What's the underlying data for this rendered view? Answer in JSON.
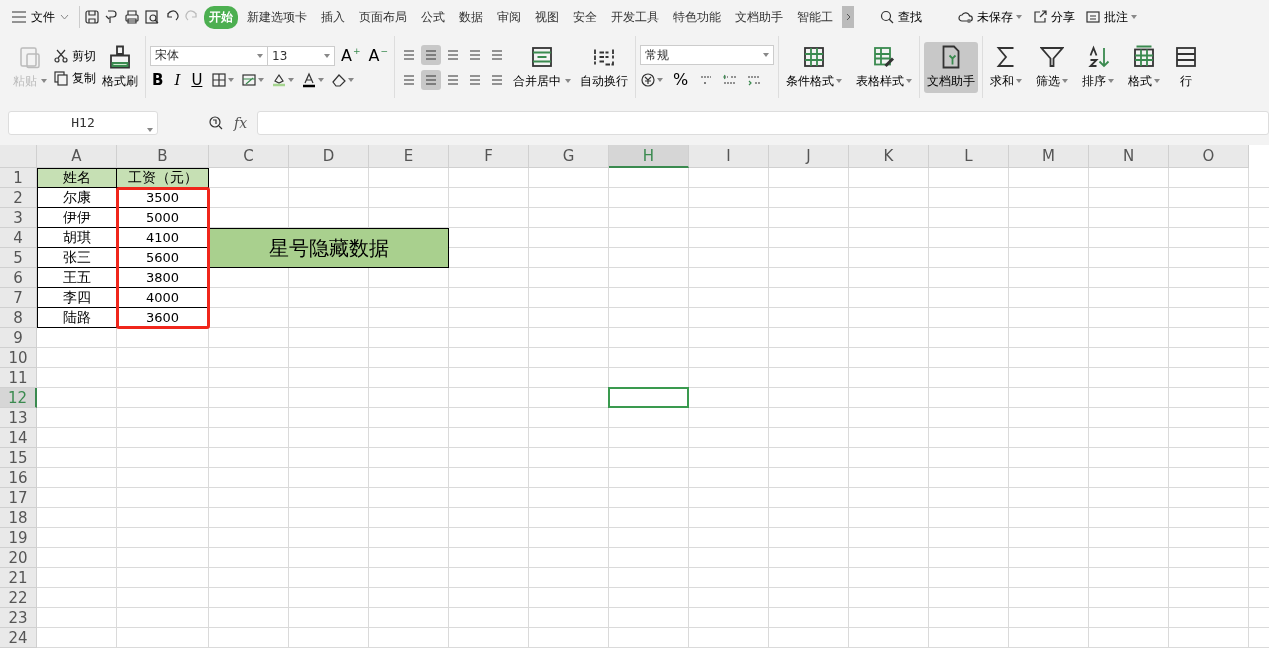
{
  "menu": {
    "label": "文件"
  },
  "tabs": [
    {
      "label": "开始",
      "selected": true
    },
    {
      "label": "新建选项卡",
      "selected": false
    },
    {
      "label": "插入",
      "selected": false
    },
    {
      "label": "页面布局",
      "selected": false
    },
    {
      "label": "公式",
      "selected": false
    },
    {
      "label": "数据",
      "selected": false
    },
    {
      "label": "审阅",
      "selected": false
    },
    {
      "label": "视图",
      "selected": false
    },
    {
      "label": "安全",
      "selected": false
    },
    {
      "label": "开发工具",
      "selected": false
    },
    {
      "label": "特色功能",
      "selected": false
    },
    {
      "label": "文档助手",
      "selected": false
    },
    {
      "label": "智能工",
      "selected": false
    }
  ],
  "actions": [
    {
      "label": "查找",
      "kind": "search",
      "dropdown": false
    },
    {
      "label": "未保存",
      "kind": "cloud",
      "dropdown": true
    },
    {
      "label": "分享",
      "kind": "share",
      "dropdown": false
    },
    {
      "label": "批注",
      "kind": "comment",
      "dropdown": true
    }
  ],
  "clipboard": {
    "paste": {
      "label": "粘贴",
      "disabled": true
    },
    "cut": "剪切",
    "copy": "复制",
    "painter": "格式刷"
  },
  "font": {
    "family": "宋体",
    "size": "13",
    "grow": {
      "text": "A",
      "mark": "+"
    },
    "shrink": {
      "text": "A",
      "mark": "−"
    },
    "styles": [
      "B",
      "I",
      "U"
    ]
  },
  "alignment": {
    "top": [
      {
        "selected": false
      },
      {
        "selected": true
      },
      {
        "selected": false
      },
      {
        "selected": false
      },
      {
        "selected": false
      }
    ],
    "bottom": [
      {
        "selected": false
      },
      {
        "selected": true
      },
      {
        "selected": false
      },
      {
        "selected": false
      },
      {
        "selected": false
      }
    ],
    "merge": "合并居中",
    "wrap": "自动换行"
  },
  "number": {
    "format": "常规",
    "percent": "%"
  },
  "large_buttons": [
    {
      "label": "条件格式",
      "kind": "cond",
      "dropdown": true,
      "selected": false
    },
    {
      "label": "表格样式",
      "kind": "style",
      "dropdown": true,
      "selected": false
    },
    {
      "label": "文档助手",
      "kind": "doc",
      "dropdown": false,
      "selected": true
    },
    {
      "label": "求和",
      "kind": "sum",
      "dropdown": true,
      "selected": false
    },
    {
      "label": "筛选",
      "kind": "filter",
      "dropdown": true,
      "selected": false
    },
    {
      "label": "排序",
      "kind": "sort",
      "dropdown": true,
      "selected": false
    },
    {
      "label": "格式",
      "kind": "format",
      "dropdown": true,
      "selected": false
    },
    {
      "label": "行",
      "kind": "rows",
      "dropdown": false,
      "selected": false
    }
  ],
  "name_box": "H12",
  "fx": "fx",
  "columns": [
    {
      "label": "A",
      "selected": false
    },
    {
      "label": "B",
      "selected": false
    },
    {
      "label": "C",
      "selected": false
    },
    {
      "label": "D",
      "selected": false
    },
    {
      "label": "E",
      "selected": false
    },
    {
      "label": "F",
      "selected": false
    },
    {
      "label": "G",
      "selected": false
    },
    {
      "label": "H",
      "selected": true
    },
    {
      "label": "I",
      "selected": false
    },
    {
      "label": "J",
      "selected": false
    },
    {
      "label": "K",
      "selected": false
    },
    {
      "label": "L",
      "selected": false
    },
    {
      "label": "M",
      "selected": false
    },
    {
      "label": "N",
      "selected": false
    },
    {
      "label": "O",
      "selected": false
    }
  ],
  "rows": [
    {
      "label": "1",
      "selected": false
    },
    {
      "label": "2",
      "selected": false
    },
    {
      "label": "3",
      "selected": false
    },
    {
      "label": "4",
      "selected": false
    },
    {
      "label": "5",
      "selected": false
    },
    {
      "label": "6",
      "selected": false
    },
    {
      "label": "7",
      "selected": false
    },
    {
      "label": "8",
      "selected": false
    },
    {
      "label": "9",
      "selected": false
    },
    {
      "label": "10",
      "selected": false
    },
    {
      "label": "11",
      "selected": false
    },
    {
      "label": "12",
      "selected": true
    },
    {
      "label": "13",
      "selected": false
    },
    {
      "label": "14",
      "selected": false
    },
    {
      "label": "15",
      "selected": false
    },
    {
      "label": "16",
      "selected": false
    },
    {
      "label": "17",
      "selected": false
    },
    {
      "label": "18",
      "selected": false
    },
    {
      "label": "19",
      "selected": false
    },
    {
      "label": "20",
      "selected": false
    },
    {
      "label": "21",
      "selected": false
    },
    {
      "label": "22",
      "selected": false
    },
    {
      "label": "23",
      "selected": false
    },
    {
      "label": "24",
      "selected": false
    }
  ],
  "table": {
    "header": [
      "姓名",
      "工资（元）"
    ],
    "rows": [
      [
        "尔康",
        "3500"
      ],
      [
        "伊伊",
        "5000"
      ],
      [
        "胡琪",
        "4100"
      ],
      [
        "张三",
        "5600"
      ],
      [
        "王五",
        "3800"
      ],
      [
        "李四",
        "4000"
      ],
      [
        "陆路",
        "3600"
      ]
    ]
  },
  "banner": {
    "text": "星号隐藏数据"
  }
}
